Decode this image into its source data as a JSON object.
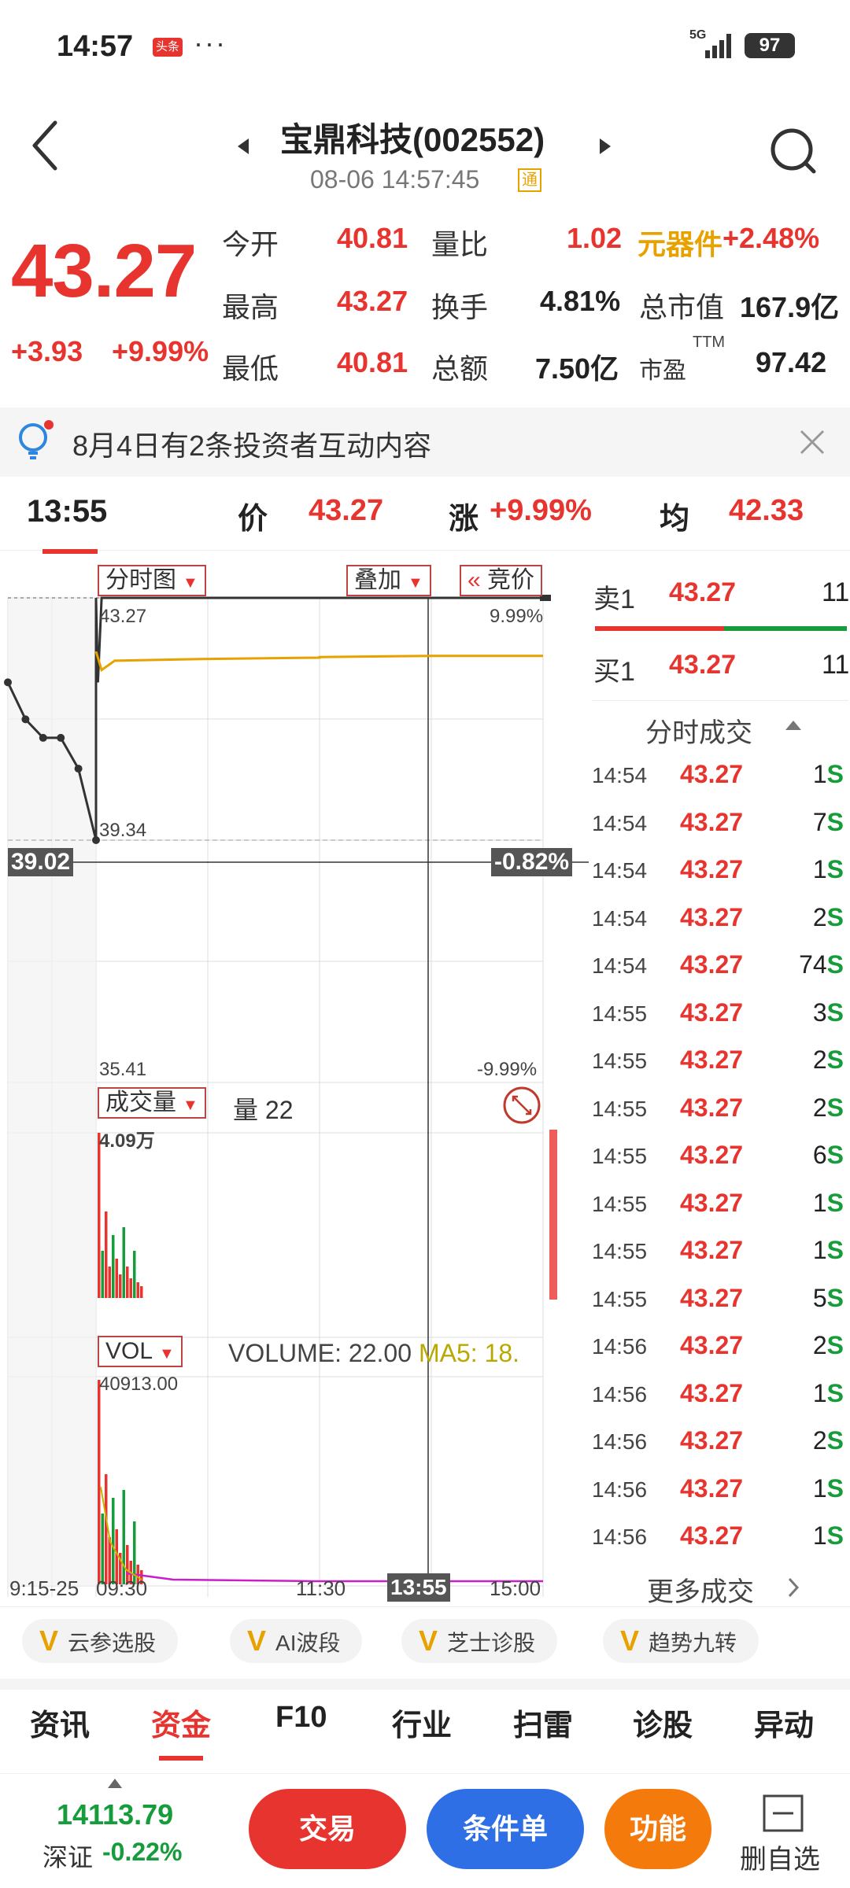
{
  "status_bar": {
    "time": "14:57",
    "badge": "头条",
    "dots": "···",
    "network": "5G",
    "battery": "97"
  },
  "header": {
    "stock_title": "宝鼎科技(002552)",
    "datetime": "08-06 14:57:45",
    "tong": "通"
  },
  "quote": {
    "price": "43.27",
    "change": "+3.93",
    "change_pct": "+9.99%",
    "rows": [
      {
        "l1": "今开",
        "v1": "40.81",
        "l2": "量比",
        "v2": "1.02",
        "l3": "元器件",
        "v3": "+2.48%"
      },
      {
        "l1": "最高",
        "v1": "43.27",
        "l2": "换手",
        "v2": "4.81%",
        "l3": "总市值",
        "v3": "167.9亿"
      },
      {
        "l1": "最低",
        "v1": "40.81",
        "l2": "总额",
        "v2": "7.50亿",
        "l3": "市盈",
        "v3": "97.42",
        "ttm": "TTM"
      }
    ]
  },
  "notice": {
    "text": "8月4日有2条投资者互动内容"
  },
  "info_row": {
    "time": "13:55",
    "price_label": "价",
    "price": "43.27",
    "change_label": "涨",
    "change": "+9.99%",
    "avg_label": "均",
    "avg": "42.33"
  },
  "chart": {
    "menu_fenshi": "分时图",
    "menu_overlay": "叠加",
    "menu_auction": "竞价",
    "auction_prefix": "«",
    "price_top": "43.27",
    "pct_top": "9.99%",
    "price_mid_low": "39.34",
    "crosshair_price": "39.02",
    "crosshair_pct": "-0.82%",
    "price_bottom": "35.41",
    "pct_bottom": "-9.99%",
    "vol_menu": "成交量",
    "vol_label": "量 22",
    "vol_max": "4.09万",
    "vol2_menu": "VOL",
    "vol2_text": "VOLUME: 22.00",
    "vol2_ma": "MA5: 18.",
    "vol2_max": "40913.00",
    "time_axis": [
      "9:15-25",
      "09:30",
      "11:30",
      "13:55",
      "15:00"
    ]
  },
  "chart_data": {
    "type": "line",
    "title": "",
    "x_ticks": [
      "9:15-25",
      "09:30",
      "11:30",
      "13:55",
      "15:00"
    ],
    "ylim": [
      35.41,
      43.27
    ],
    "series": [
      {
        "name": "",
        "x": [
          "9:15",
          "9:17",
          "9:19",
          "9:21",
          "9:23",
          "9:25",
          "9:30",
          "9:31",
          "9:33",
          "9:40",
          "10:30",
          "11:30",
          "13:00",
          "14:00",
          "15:00"
        ],
        "values": [
          41.9,
          41.3,
          41.0,
          41.0,
          40.5,
          39.34,
          43.27,
          41.9,
          43.27,
          43.27,
          43.27,
          43.27,
          43.27,
          43.27,
          43.27
        ]
      },
      {
        "name": "",
        "x": [
          "9:30",
          "9:33",
          "9:40",
          "10:30",
          "11:30",
          "13:00",
          "14:00",
          "15:00"
        ],
        "values": [
          42.4,
          42.1,
          42.25,
          42.28,
          42.3,
          42.31,
          42.33,
          42.33
        ]
      }
    ]
  },
  "order_book": {
    "sell_label": "卖1",
    "sell_price": "43.27",
    "sell_vol": "11",
    "buy_label": "买1",
    "buy_price": "43.27",
    "buy_vol": "11"
  },
  "ticks_header": "分时成交",
  "ticks": [
    {
      "t": "14:54",
      "p": "43.27",
      "v": "1",
      "s": "S"
    },
    {
      "t": "14:54",
      "p": "43.27",
      "v": "7",
      "s": "S"
    },
    {
      "t": "14:54",
      "p": "43.27",
      "v": "1",
      "s": "S"
    },
    {
      "t": "14:54",
      "p": "43.27",
      "v": "2",
      "s": "S"
    },
    {
      "t": "14:54",
      "p": "43.27",
      "v": "74",
      "s": "S"
    },
    {
      "t": "14:55",
      "p": "43.27",
      "v": "3",
      "s": "S"
    },
    {
      "t": "14:55",
      "p": "43.27",
      "v": "2",
      "s": "S"
    },
    {
      "t": "14:55",
      "p": "43.27",
      "v": "2",
      "s": "S"
    },
    {
      "t": "14:55",
      "p": "43.27",
      "v": "6",
      "s": "S"
    },
    {
      "t": "14:55",
      "p": "43.27",
      "v": "1",
      "s": "S"
    },
    {
      "t": "14:55",
      "p": "43.27",
      "v": "1",
      "s": "S"
    },
    {
      "t": "14:55",
      "p": "43.27",
      "v": "5",
      "s": "S"
    },
    {
      "t": "14:56",
      "p": "43.27",
      "v": "2",
      "s": "S"
    },
    {
      "t": "14:56",
      "p": "43.27",
      "v": "1",
      "s": "S"
    },
    {
      "t": "14:56",
      "p": "43.27",
      "v": "2",
      "s": "S"
    },
    {
      "t": "14:56",
      "p": "43.27",
      "v": "1",
      "s": "S"
    },
    {
      "t": "14:56",
      "p": "43.27",
      "v": "1",
      "s": "S"
    }
  ],
  "more_ticks": "更多成交",
  "strategies": [
    "云参选股",
    "AI波段",
    "芝士诊股",
    "趋势九转"
  ],
  "strategy_v": "V",
  "tabs": [
    "资讯",
    "资金",
    "F10",
    "行业",
    "扫雷",
    "诊股",
    "异动"
  ],
  "bottom": {
    "index_value": "14113.79",
    "index_name": "深证",
    "index_change": "-0.22%",
    "trade_btn": "交易",
    "condition_btn": "条件单",
    "function_btn": "功能",
    "fav_label": "删自选"
  },
  "colors": {
    "red": "#e8342f",
    "green": "#169c3a",
    "orange": "#e8a200",
    "blue": "#2e6fe6"
  }
}
